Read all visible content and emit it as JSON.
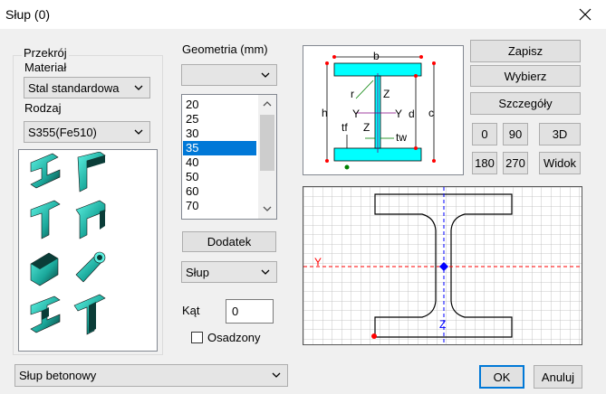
{
  "window": {
    "title": "Słup (0)"
  },
  "section_group": {
    "label": "Przekrój",
    "material_label": "Materiał",
    "material_value": "Stal standardowa",
    "type_label": "Rodzaj",
    "type_value": "S355(Fe510)"
  },
  "geometry": {
    "label": "Geometria (mm)",
    "combo_value": "",
    "list_items": [
      "20",
      "25",
      "30",
      "35",
      "40",
      "50",
      "60",
      "70"
    ],
    "selected_index": 3,
    "add_button": "Dodatek",
    "element_combo": "Słup"
  },
  "buttons": {
    "save": "Zapisz",
    "choose": "Wybierz",
    "details": "Szczegóły",
    "rot0": "0",
    "rot90": "90",
    "view3d": "3D",
    "rot180": "180",
    "rot270": "270",
    "view": "Widok",
    "ok": "OK",
    "cancel": "Anuluj"
  },
  "angle": {
    "label": "Kąt",
    "value": "0"
  },
  "embedded": {
    "label": "Osadzony",
    "checked": false
  },
  "bottom_combo": {
    "value": "Słup betonowy"
  },
  "diagram": {
    "labels": {
      "b": "b",
      "h": "h",
      "r": "r",
      "z": "Z",
      "y": "Y",
      "d": "d",
      "c": "c",
      "tf": "tf",
      "tw": "tw",
      "y2": "Y",
      "z2": "Z"
    }
  },
  "preview": {
    "axis_y": "Y",
    "axis_z": "Z"
  },
  "colors": {
    "profile": "#00ffff",
    "accent": "#0078d7",
    "axis_red": "#ff0000",
    "axis_blue": "#0000ff"
  },
  "icons": [
    "profile-i-icon",
    "profile-angle-icon",
    "profile-t-icon",
    "profile-channel-icon",
    "profile-rect-tube-icon",
    "profile-round-tube-icon",
    "profile-double-angle-icon",
    "profile-double-t-icon"
  ]
}
